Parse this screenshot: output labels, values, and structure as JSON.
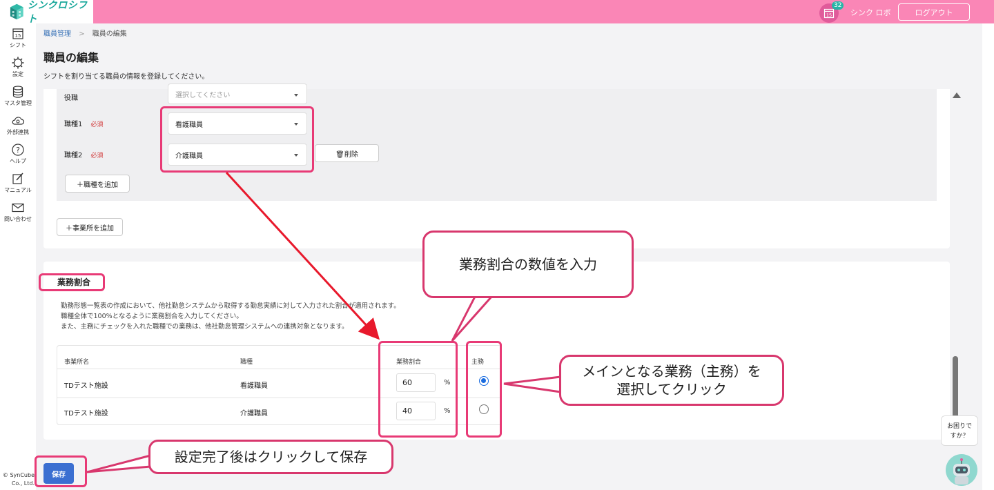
{
  "app": {
    "logo_text": "シンクロシフト"
  },
  "header": {
    "calendar_day": "15",
    "notification_count": "32",
    "user_name": "シンク ロボ",
    "logout_label": "ログアウト"
  },
  "sidebar": {
    "items": [
      {
        "label": "シフト",
        "icon": "calendar-icon",
        "day": "15"
      },
      {
        "label": "設定",
        "icon": "gear-icon"
      },
      {
        "label": "マスタ管理",
        "icon": "database-icon"
      },
      {
        "label": "外部連携",
        "icon": "cloud-sync-icon"
      },
      {
        "label": "ヘルプ",
        "icon": "help-icon"
      },
      {
        "label": "マニュアル",
        "icon": "edit-icon"
      },
      {
        "label": "問い合わせ",
        "icon": "mail-icon"
      }
    ],
    "copyright_line1": "© SynCube",
    "copyright_line2": "Co., Ltd."
  },
  "breadcrumb": {
    "parent": "職員管理",
    "separator": ">",
    "current": "職員の編集"
  },
  "page": {
    "title": "職員の編集",
    "description": "シフトを割り当てる職員の情報を登録してください。"
  },
  "form": {
    "position_label": "役職",
    "position_placeholder": "選択してください",
    "job1_label": "職種1",
    "job2_label": "職種2",
    "required_label": "必須",
    "job1_value": "看護職員",
    "job2_value": "介護職員",
    "delete_label": "🗑削除",
    "add_job_label": "＋職種を追加",
    "add_office_label": "＋事業所を追加"
  },
  "ratio_section": {
    "title": "業務割合",
    "desc_line1": "勤務形態一覧表の作成において、他社勤怠システムから取得する勤怠実績に対して入力された割合が適用されます。",
    "desc_line2": "職種全体で100%となるように業務割合を入力してください。",
    "desc_line3": "また、主務にチェックを入れた職種での業務は、他社勤怠管理システムへの連携対象となります。",
    "columns": [
      "事業所名",
      "職種",
      "業務割合",
      "主務"
    ],
    "rows": [
      {
        "office": "TDテスト施設",
        "job": "看護職員",
        "ratio": "60",
        "unit": "%",
        "main": true
      },
      {
        "office": "TDテスト施設",
        "job": "介護職員",
        "ratio": "40",
        "unit": "%",
        "main": false
      }
    ]
  },
  "save_label": "保存",
  "help_widget": {
    "line1": "お困りで",
    "line2": "すか？"
  },
  "annotations": {
    "callout_ratio": "業務割合の数値を入力",
    "callout_main_line1": "メインとなる業務（主務）を",
    "callout_main_line2": "選択してクリック",
    "callout_save": "設定完了後はクリックして保存"
  },
  "colors": {
    "header": "#fa86b6",
    "accent_teal": "#19a89b",
    "primary_button": "#3b6fd1",
    "highlight": "#e83a76"
  }
}
